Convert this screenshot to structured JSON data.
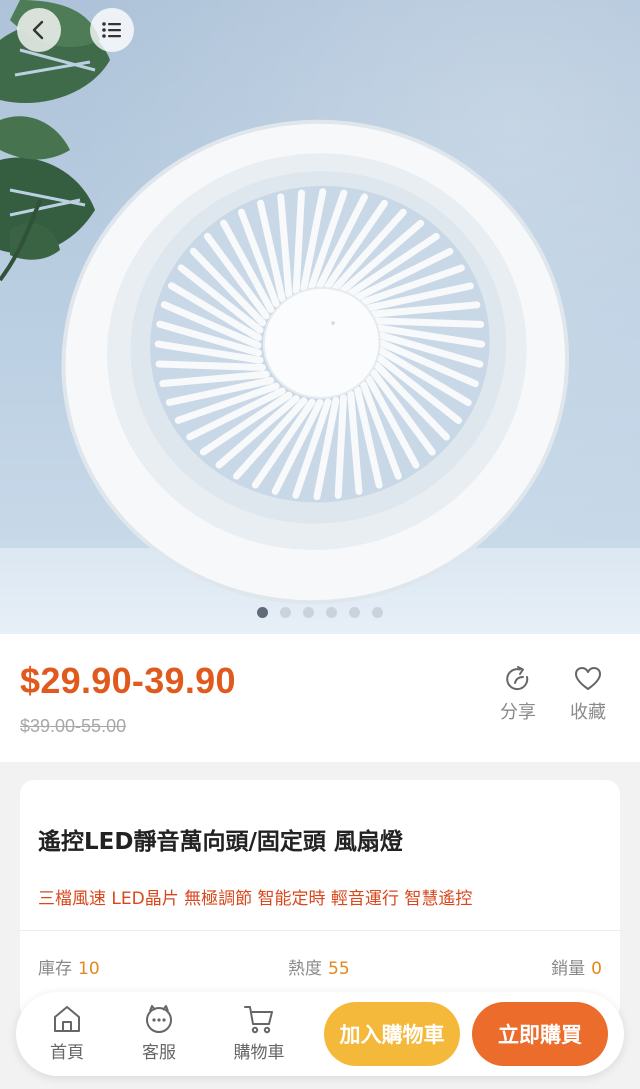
{
  "gallery": {
    "dot_count": 6,
    "active_index": 0
  },
  "price": {
    "current": "$29.90-39.90",
    "original": "$39.00-55.00"
  },
  "actions": {
    "share_label": "分享",
    "favorite_label": "收藏"
  },
  "product": {
    "title": "遙控LED靜音萬向頭/固定頭 風扇燈",
    "tags": "三檔風速 LED晶片 無極調節 智能定時 輕音運行 智慧遙控"
  },
  "stats": {
    "stock_label": "庫存",
    "stock_value": "10",
    "heat_label": "熱度",
    "heat_value": "55",
    "sales_label": "銷量",
    "sales_value": "0"
  },
  "bottom_nav": {
    "home_label": "首頁",
    "service_label": "客服",
    "cart_label": "購物車",
    "add_to_cart_label": "加入購物車",
    "buy_now_label": "立即購買"
  },
  "colors": {
    "price": "#e05a1e",
    "tags": "#d9471d",
    "stat_value": "#e0891e",
    "add_button": "#f4b93b",
    "buy_button": "#ec6c2c"
  },
  "icons": [
    "back-icon",
    "menu-list-icon",
    "share-icon",
    "heart-icon",
    "home-icon",
    "chat-bot-icon",
    "cart-icon"
  ]
}
